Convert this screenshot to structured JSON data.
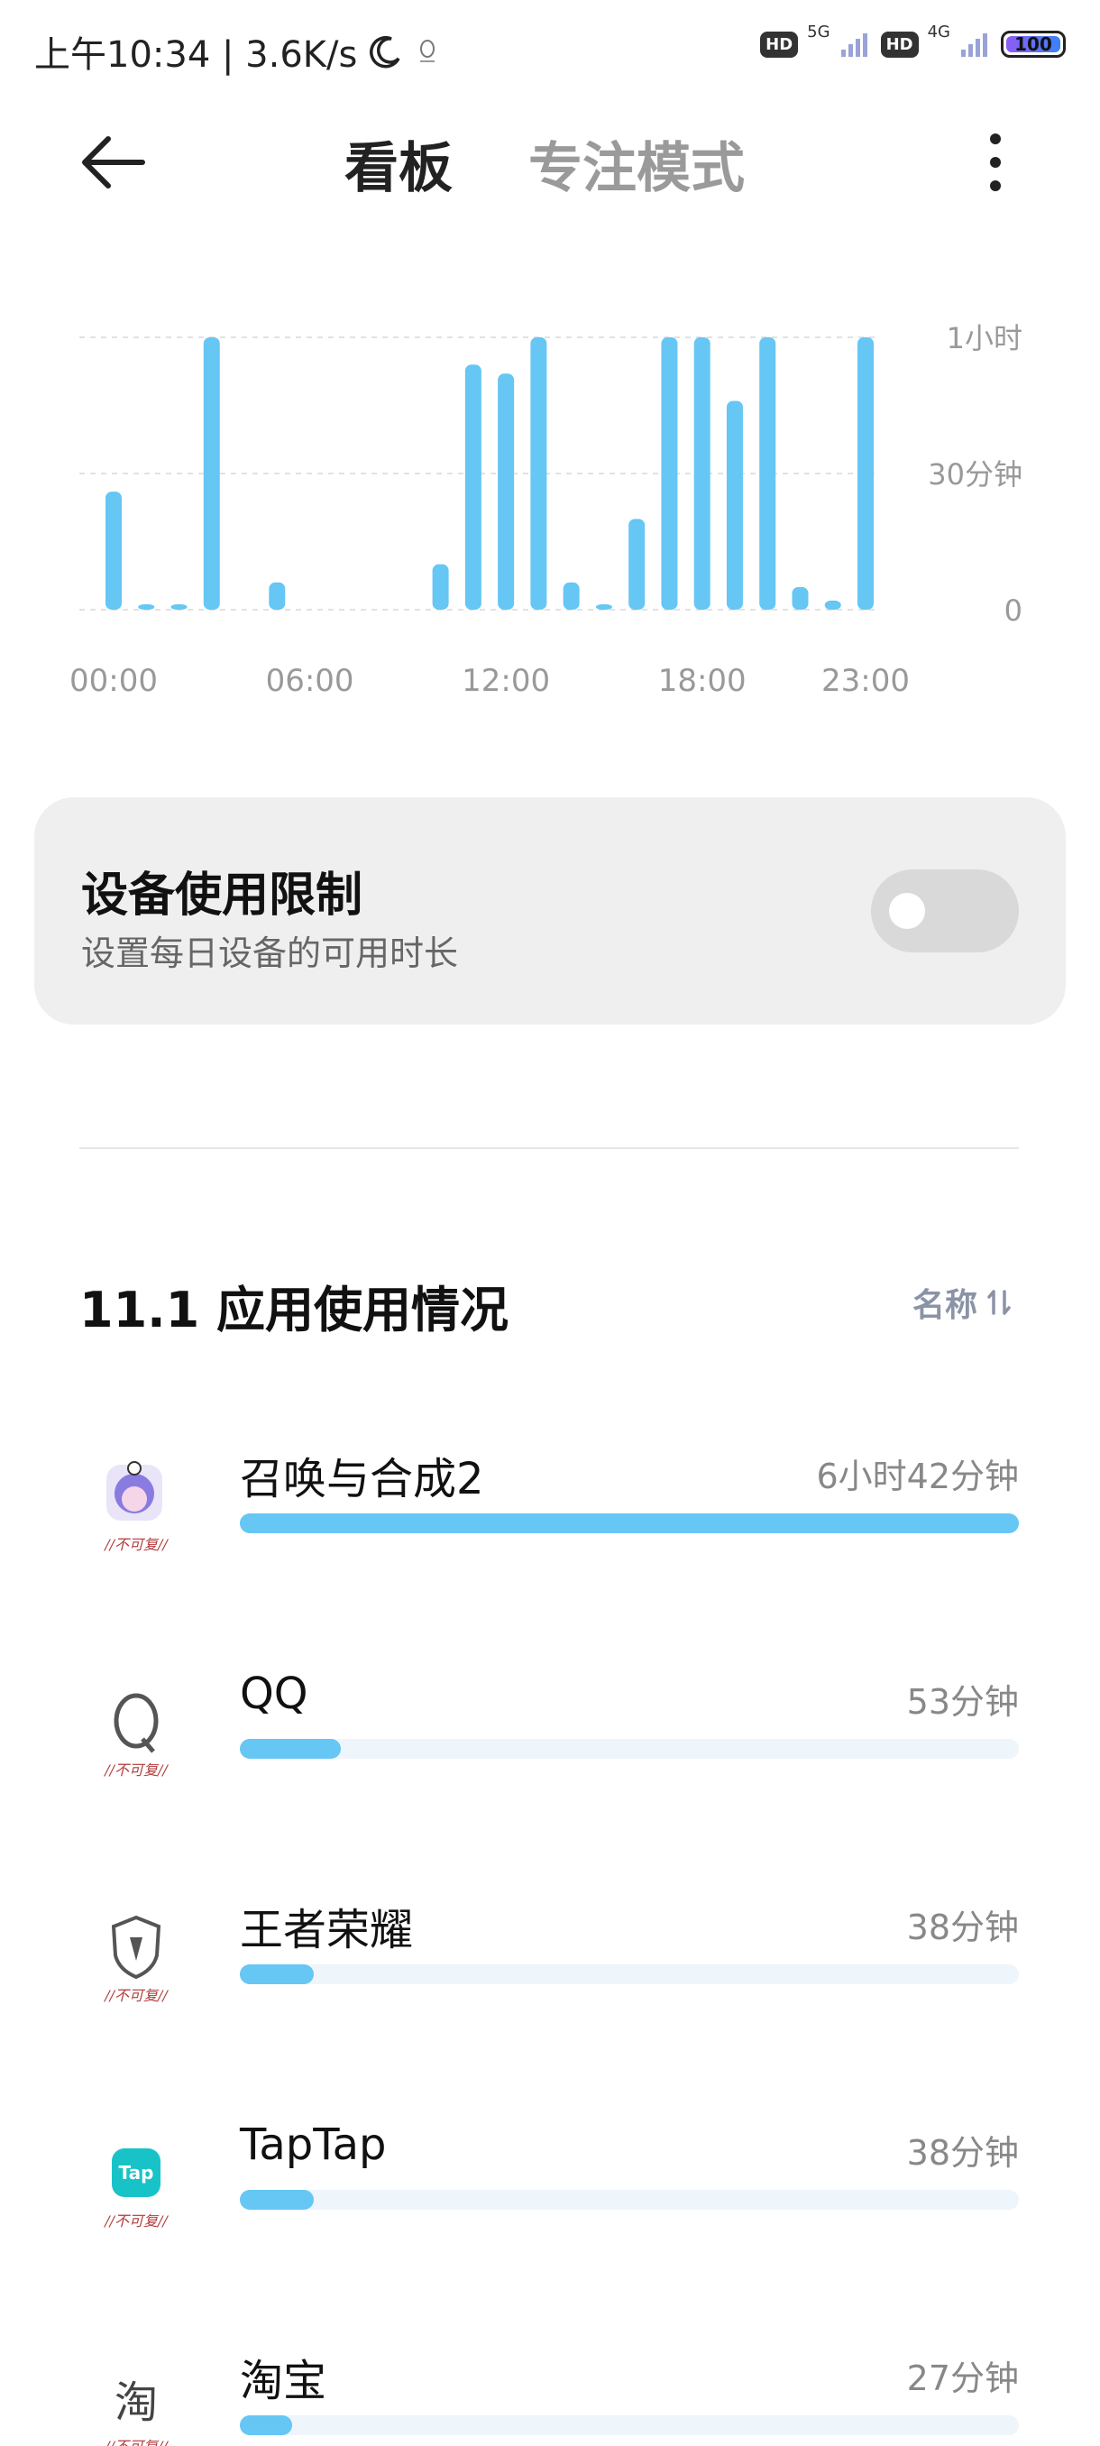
{
  "status_bar": {
    "time_speed": "上午10:34 | 3.6K/s",
    "network_1": "5G",
    "network_2": "4G",
    "hd_label": "HD",
    "battery": "100"
  },
  "header": {
    "tab_dashboard": "看板",
    "tab_focus": "专注模式",
    "back_icon": "back-arrow-icon",
    "more_icon": "more-vertical-icon"
  },
  "chart_data": {
    "type": "bar",
    "categories": [
      "00:00",
      "01:00",
      "02:00",
      "03:00",
      "04:00",
      "05:00",
      "06:00",
      "07:00",
      "08:00",
      "09:00",
      "10:00",
      "11:00",
      "12:00",
      "13:00",
      "14:00",
      "15:00",
      "16:00",
      "17:00",
      "18:00",
      "19:00",
      "20:00",
      "21:00",
      "22:00",
      "23:00"
    ],
    "values": [
      26,
      1,
      1,
      60,
      0,
      6,
      0,
      0,
      0,
      0,
      10,
      54,
      52,
      60,
      6,
      1,
      20,
      60,
      60,
      46,
      60,
      5,
      2,
      60
    ],
    "x_tick_labels": [
      "00:00",
      "06:00",
      "12:00",
      "18:00",
      "23:00"
    ],
    "y_tick_labels": [
      "1小时",
      "30分钟",
      "0"
    ],
    "ylim": [
      0,
      60
    ],
    "grid": true,
    "color": "#66c6f4"
  },
  "limit": {
    "title": "设备使用限制",
    "subtitle": "设置每日设备的可用时长",
    "enabled": false
  },
  "usage": {
    "title": "11.1 应用使用情况",
    "sort_label": "名称",
    "apps": [
      {
        "name": "召唤与合成2",
        "time": "6小时42分钟",
        "fraction": 1.0
      },
      {
        "name": "QQ",
        "time": "53分钟",
        "fraction": 0.13
      },
      {
        "name": "王者荣耀",
        "time": "38分钟",
        "fraction": 0.095
      },
      {
        "name": "TapTap",
        "time": "38分钟",
        "fraction": 0.095
      },
      {
        "name": "淘宝",
        "time": "27分钟",
        "fraction": 0.067
      }
    ]
  },
  "colors": {
    "accent": "#66c6f4",
    "track": "#eef5fb",
    "card": "#efefef"
  }
}
